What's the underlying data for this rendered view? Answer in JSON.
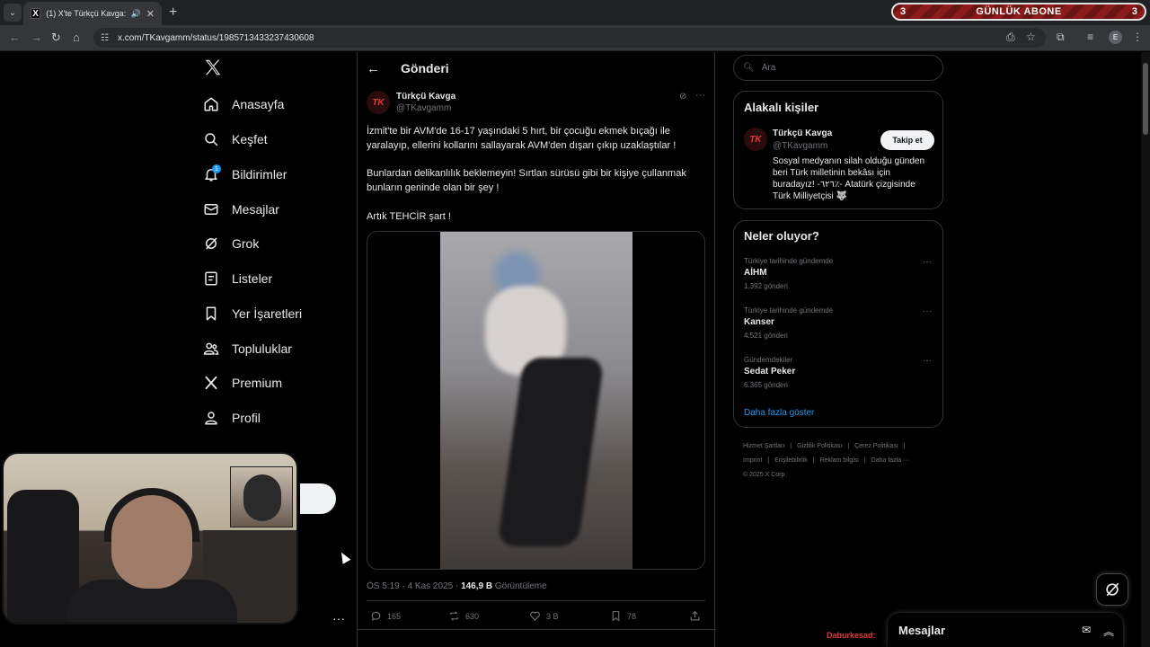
{
  "browser": {
    "tab_title": "(1) X'te Türkçü Kavga: \"İzmi",
    "tab_favicon": "X",
    "url": "x.com/TKavgamm/status/1985713433237430608",
    "profile_initial": "E"
  },
  "stream_banner": {
    "label": "GÜNLÜK ABONE",
    "left_count": "3",
    "right_count": "3"
  },
  "nav": {
    "items": [
      {
        "label": "Anasayfa",
        "icon": "home-icon"
      },
      {
        "label": "Keşfet",
        "icon": "search-icon"
      },
      {
        "label": "Bildirimler",
        "icon": "bell-icon",
        "badge": "1"
      },
      {
        "label": "Mesajlar",
        "icon": "mail-icon"
      },
      {
        "label": "Grok",
        "icon": "grok-icon"
      },
      {
        "label": "Listeler",
        "icon": "list-icon"
      },
      {
        "label": "Yer İşaretleri",
        "icon": "bookmark-icon"
      },
      {
        "label": "Topluluklar",
        "icon": "communities-icon"
      },
      {
        "label": "Premium",
        "icon": "x-icon"
      },
      {
        "label": "Profil",
        "icon": "profile-icon"
      }
    ]
  },
  "post": {
    "page_title": "Gönderi",
    "author_name": "Türkçü Kavga",
    "author_handle": "@TKavgamm",
    "avatar_text": "TK",
    "paragraphs": [
      "İzmit'te bir AVM'de 16-17 yaşındaki 5 hırt, bir çocuğu ekmek bıçağı ile yaralayıp, ellerini kollarını sallayarak AVM'den dışarı çıkıp uzaklaştılar !",
      "Bunlardan delikanlılık beklemeyin! Sırtlan sürüsü gibi bir kişiye çullanmak bunların geninde olan bir şey !",
      "Artık TEHCİR şart !"
    ],
    "time": "ÖS 5:19 · 4 Kas 2025 · ",
    "views": "146,9 B",
    "views_label": " Görüntüleme",
    "replies": "165",
    "reposts": "630",
    "likes": "3 B",
    "bookmarks": "78"
  },
  "right": {
    "search_placeholder": "Ara",
    "related_title": "Alakalı kişiler",
    "related": {
      "name": "Türkçü Kavga",
      "handle": "@TKavgamm",
      "avatar_text": "TK",
      "follow_label": "Takip et",
      "bio": "Sosyal medyanın silah olduğu günden beri Türk milletinin bekâsı için buradayız! -٦٢٦٪- Atatürk çizgisinde Türk Milliyetçisi 🐺"
    },
    "trends_title": "Neler oluyor?",
    "trends": [
      {
        "context": "Türkiye tarihinde gündemde",
        "name": "AİHM",
        "count": "1.392 gönderi"
      },
      {
        "context": "Türkiye tarihinde gündemde",
        "name": "Kanser",
        "count": "4.521 gönderi"
      },
      {
        "context": "Gündemdekiler",
        "name": "Sedat Peker",
        "count": "6.365 gönderi"
      }
    ],
    "show_more": "Daha fazla göster",
    "footer": [
      "Hizmet Şartları",
      "|",
      "Gizlilik Politikası",
      "|",
      "Çerez Politikası",
      "|",
      "Imprint",
      "|",
      "Erişilebilirlik",
      "|",
      "Reklam bilgisi",
      "|",
      "Daha fazla ···",
      "© 2025 X Corp."
    ]
  },
  "messages_drawer": {
    "label": "Mesajlar"
  },
  "overlay_username": "Daburkesad:",
  "colors": {
    "accent": "#1d9bf0",
    "brand_red": "#e03a3a",
    "background": "#000000"
  }
}
